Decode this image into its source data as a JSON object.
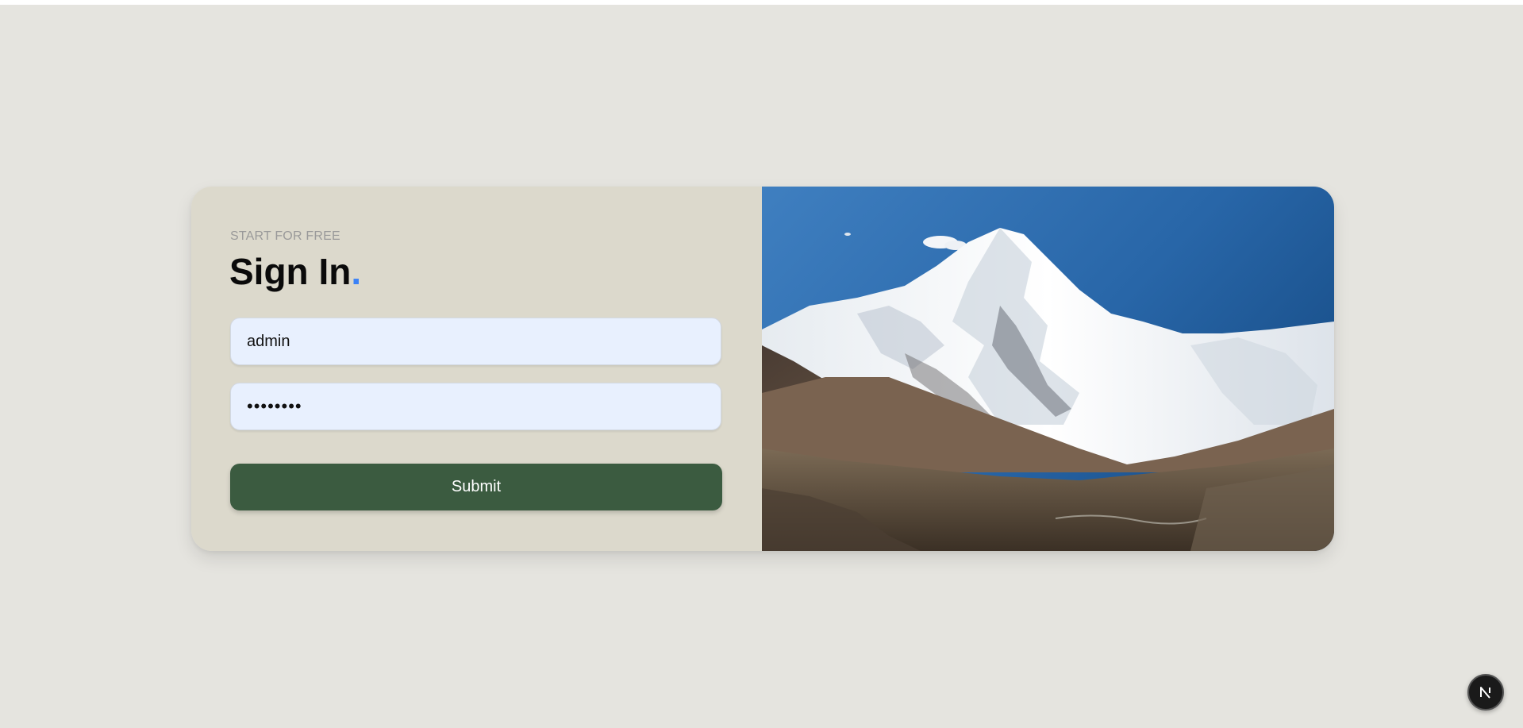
{
  "form": {
    "eyebrow": "START FOR FREE",
    "title": "Sign In",
    "title_dot": ".",
    "username_value": "admin",
    "password_value": "••••••••",
    "submit_label": "Submit"
  },
  "image": {
    "subject": "snow-capped mountain landscape"
  },
  "dev_badge": {
    "icon": "next-logo-icon"
  },
  "colors": {
    "page_background": "#e5e4df",
    "panel_background": "#dcd9cc",
    "input_background": "#e8f0fe",
    "button_background": "#3b5b40",
    "accent_dot": "#3b82f6"
  }
}
